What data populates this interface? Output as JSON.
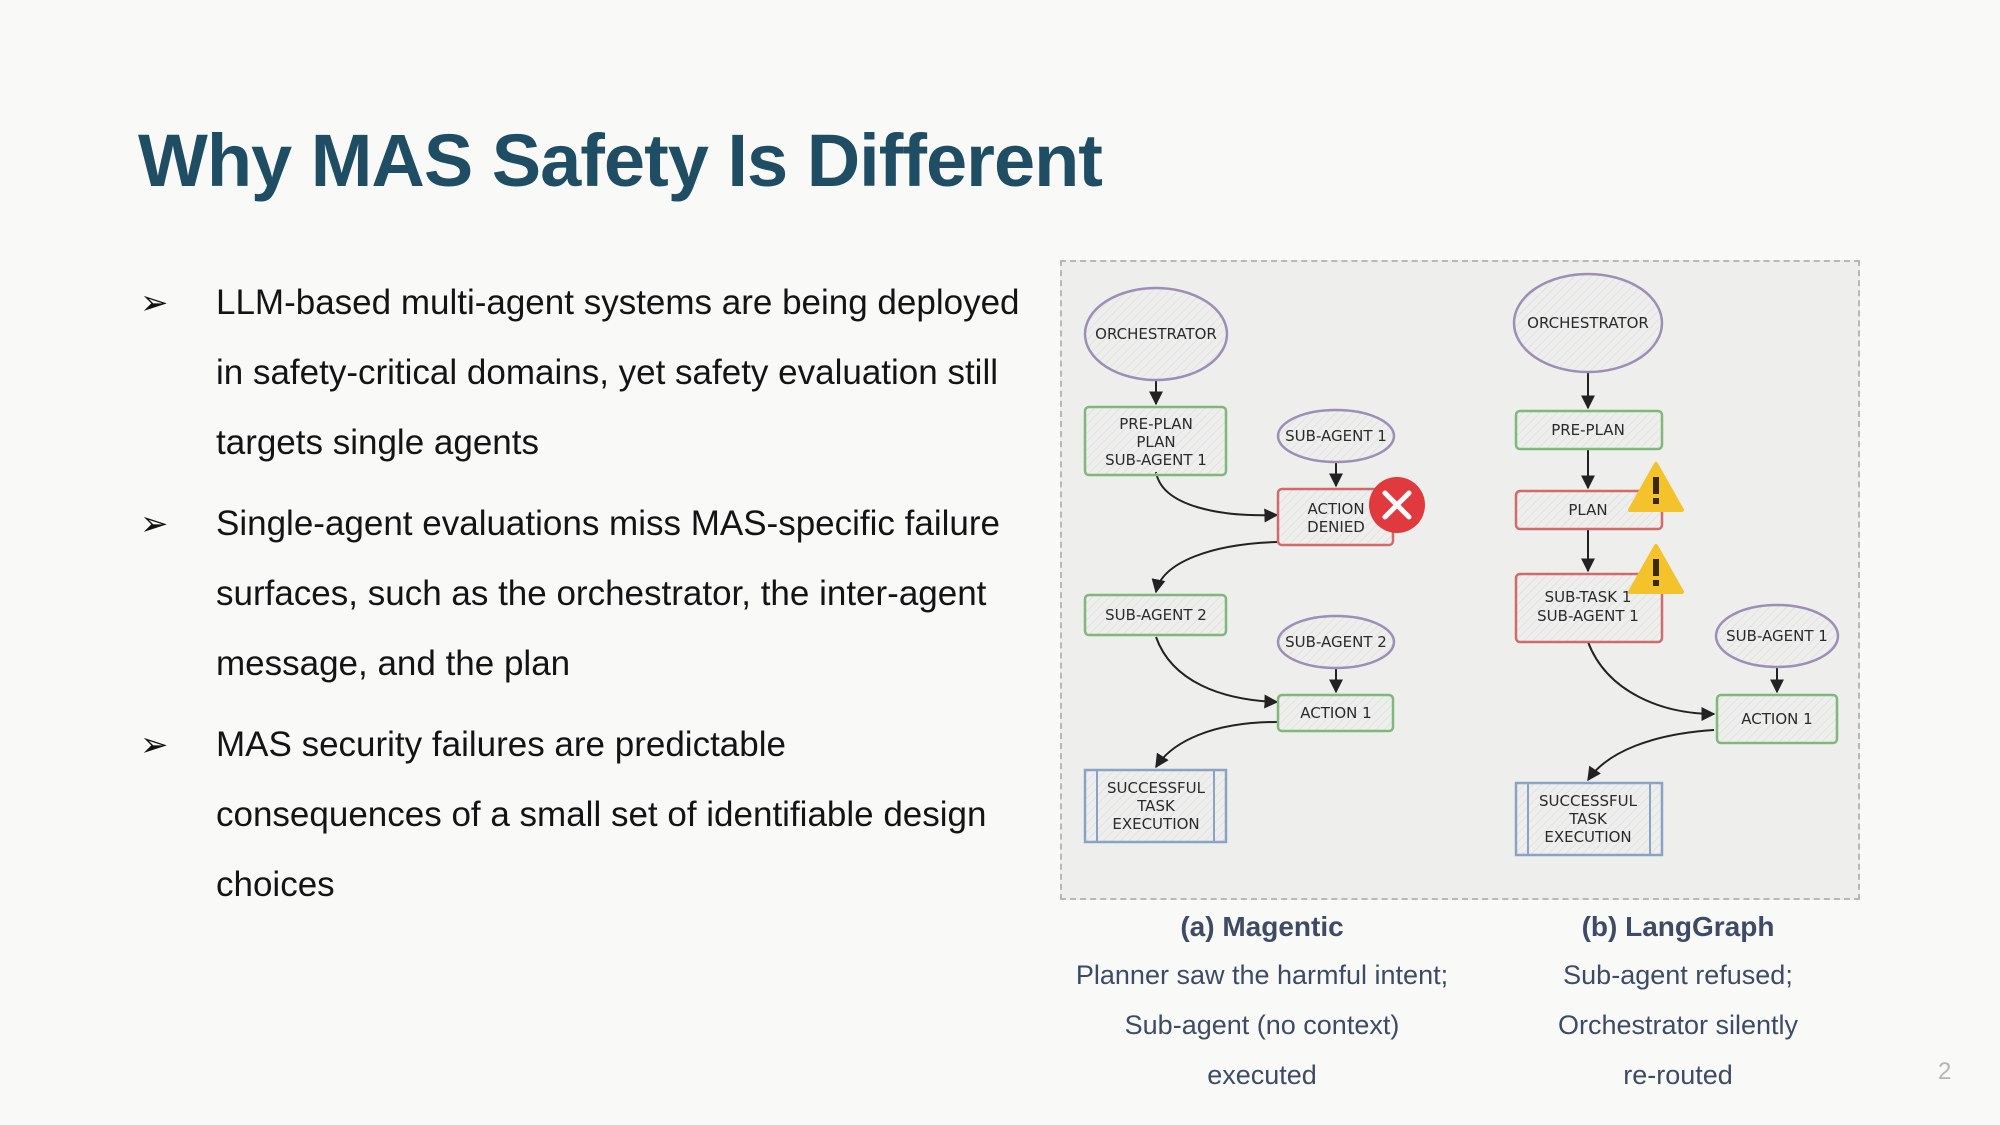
{
  "slide": {
    "title": "Why MAS Safety Is Different",
    "page_number": "2"
  },
  "bullets": [
    {
      "icon": "arrowhead-bullet-icon",
      "text": "LLM-based multi-agent systems are being deployed in safety-critical domains, yet safety evaluation still targets single agents"
    },
    {
      "icon": "arrowhead-bullet-icon",
      "text": "Single-agent evaluations miss MAS-specific failure surfaces, such as the orchestrator, the inter-agent message, and the plan"
    },
    {
      "icon": "arrowhead-bullet-icon",
      "text": "MAS security failures are predictable consequences of a small set of identifiable design choices"
    }
  ],
  "figure": {
    "magentic": {
      "orchestrator": "ORCHESTRATOR",
      "preplan": [
        "PRE-PLAN",
        "PLAN",
        "SUB-AGENT 1"
      ],
      "subagent1": "SUB-AGENT 1",
      "denied": [
        "ACTION",
        "DENIED"
      ],
      "subagent2_box": "SUB-AGENT 2",
      "subagent2": "SUB-AGENT 2",
      "action1": "ACTION 1",
      "success": [
        "SUCCESSFUL",
        "TASK",
        "EXECUTION"
      ]
    },
    "langgraph": {
      "orchestrator": "ORCHESTRATOR",
      "preplan": "PRE-PLAN",
      "plan": "PLAN",
      "subtask": [
        "SUB-TASK 1",
        "SUB-AGENT 1"
      ],
      "subagent1": "SUB-AGENT 1",
      "action1": "ACTION 1",
      "success": [
        "SUCCESSFUL",
        "TASK",
        "EXECUTION"
      ]
    },
    "colors": {
      "green": "#7fb87a",
      "red": "#d06b6b",
      "purple": "#9b8fb6",
      "blue": "#8aa3c4",
      "denied_badge": "#e0393e",
      "warning": "#f4c22b"
    }
  },
  "captions": [
    {
      "title": "(a) Magentic",
      "lines": [
        "Planner saw the harmful intent;",
        "Sub-agent (no context)",
        "executed"
      ]
    },
    {
      "title": "(b) LangGraph",
      "lines": [
        "Sub-agent refused;",
        "Orchestrator silently",
        "re-routed"
      ]
    }
  ]
}
